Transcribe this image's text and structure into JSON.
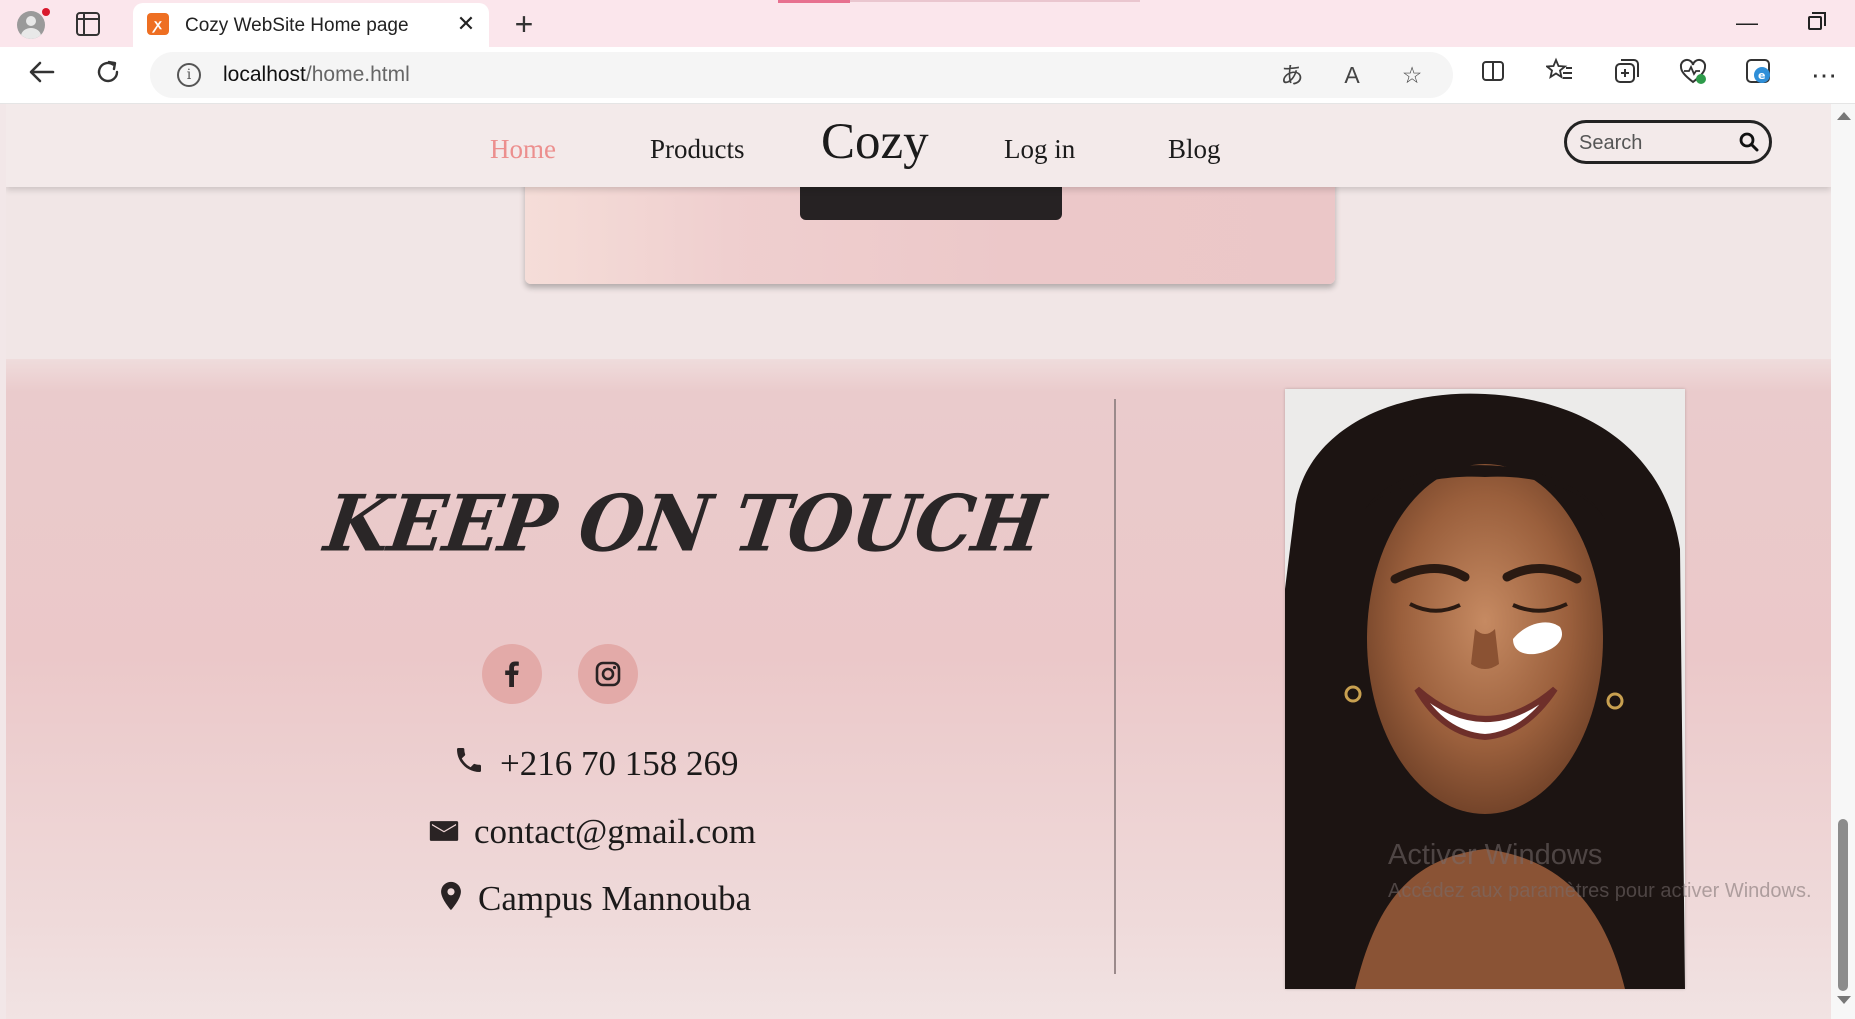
{
  "browser": {
    "tab_title": "Cozy WebSite Home page",
    "tab_favicon": "xampp-icon",
    "address_host": "localhost",
    "address_path": "/home.html",
    "new_tab_glyph": "+",
    "close_glyph": "✕"
  },
  "nav": {
    "home": "Home",
    "products": "Products",
    "logo": "Cozy",
    "login": "Log in",
    "blog": "Blog",
    "search_placeholder": "Search",
    "active_color": "#ec8f8e"
  },
  "footer": {
    "heading": "KEEP ON TOUCH",
    "socials": [
      "facebook-icon",
      "instagram-icon"
    ],
    "phone": "+216 70 158 269",
    "email": "contact@gmail.com",
    "location": "Campus Mannouba",
    "accent_color": "#e3aaa8"
  },
  "watermark": {
    "line1": "Activer Windows",
    "line2": "Accédez aux paramètres pour activer Windows."
  }
}
